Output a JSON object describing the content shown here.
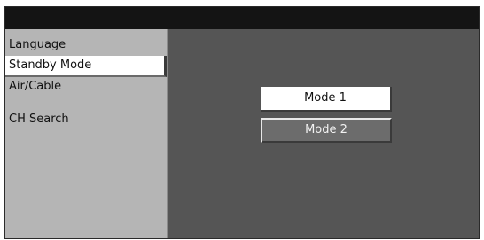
{
  "menu": {
    "items": [
      {
        "label": "Language"
      },
      {
        "label": "Standby Mode",
        "selected": true
      },
      {
        "label": "Air/Cable"
      },
      {
        "label": "CH Search"
      }
    ]
  },
  "standby_mode": {
    "options": [
      {
        "label": "Mode 1",
        "selected": true
      },
      {
        "label": "Mode 2"
      }
    ]
  },
  "colors": {
    "title_bar": "#141414",
    "sidebar": "#b5b5b5",
    "content": "#555555",
    "highlight": "#ffffff"
  }
}
